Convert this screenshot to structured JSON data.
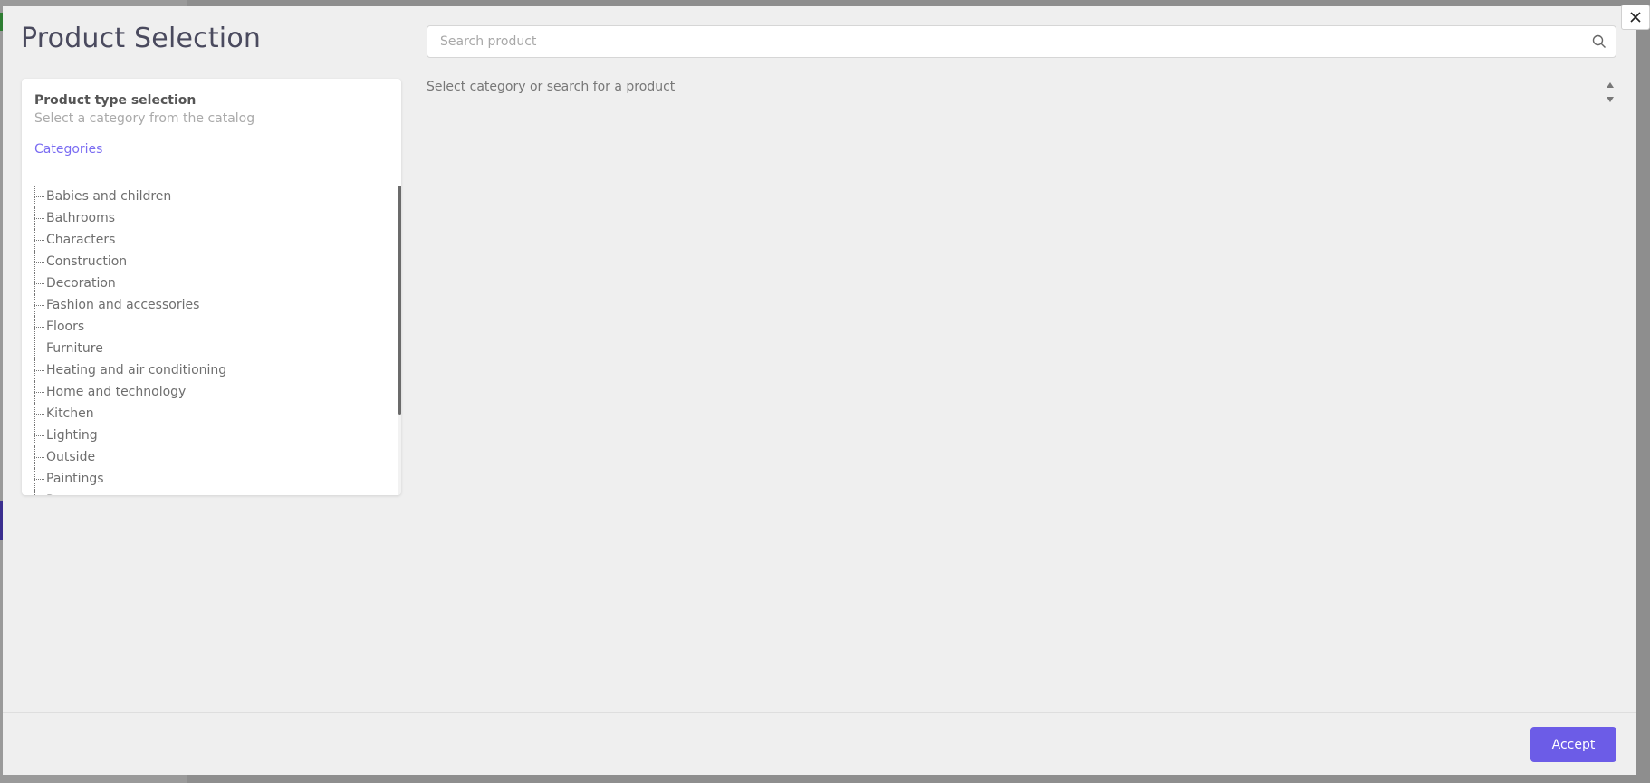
{
  "modal": {
    "title": "Product Selection",
    "close_icon": "close-icon"
  },
  "search": {
    "placeholder": "Search product",
    "value": "",
    "icon": "search-icon"
  },
  "results": {
    "empty_message": "Select category or search for a product",
    "sort_icon": "sort-arrows-icon"
  },
  "panel": {
    "title": "Product type selection",
    "subtitle": "Select a category from the catalog",
    "categories_link": "Categories",
    "items": [
      {
        "label": "Babies and children"
      },
      {
        "label": "Bathrooms"
      },
      {
        "label": "Characters"
      },
      {
        "label": "Construction"
      },
      {
        "label": "Decoration"
      },
      {
        "label": "Fashion and accessories"
      },
      {
        "label": "Floors"
      },
      {
        "label": "Furniture"
      },
      {
        "label": "Heating and air conditioning"
      },
      {
        "label": "Home and technology"
      },
      {
        "label": "Kitchen"
      },
      {
        "label": "Lighting"
      },
      {
        "label": "Outside"
      },
      {
        "label": "Paintings"
      },
      {
        "label": "Pets"
      }
    ]
  },
  "footer": {
    "accept_label": "Accept"
  },
  "colors": {
    "accent": "#6c5ce7",
    "link": "#7a6cf2",
    "modal_bg": "#efefef",
    "backdrop": "#8e8e8e"
  }
}
